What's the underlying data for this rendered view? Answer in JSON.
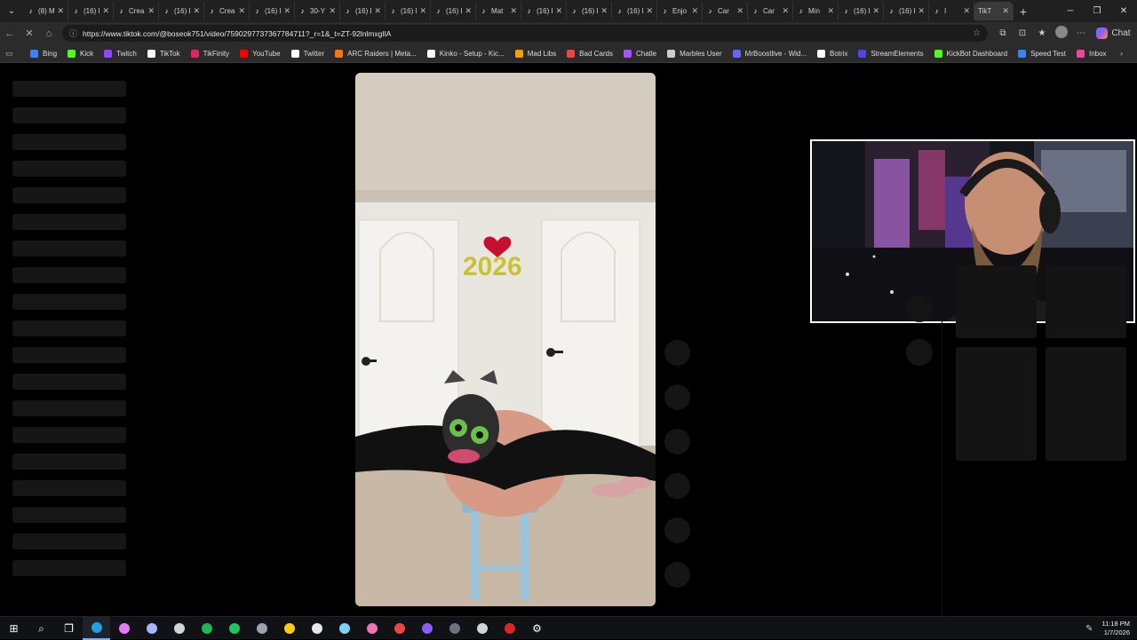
{
  "tabs": [
    {
      "label": "(8) M",
      "icon": "tiktok-icon"
    },
    {
      "label": "(16) I",
      "icon": "tiktok-icon"
    },
    {
      "label": "Crea",
      "icon": "tiktok-icon"
    },
    {
      "label": "(16) I",
      "icon": "tiktok-icon"
    },
    {
      "label": "Crea",
      "icon": "tiktok-icon"
    },
    {
      "label": "(16) I",
      "icon": "tiktok-icon"
    },
    {
      "label": "30-Y",
      "icon": "tiktok-icon"
    },
    {
      "label": "(16) I",
      "icon": "tiktok-icon"
    },
    {
      "label": "(16) I",
      "icon": "tiktok-icon"
    },
    {
      "label": "(16) I",
      "icon": "tiktok-icon"
    },
    {
      "label": "Mat",
      "icon": "tiktok-icon"
    },
    {
      "label": "(16) I",
      "icon": "tiktok-icon"
    },
    {
      "label": "(16) I",
      "icon": "tiktok-icon"
    },
    {
      "label": "(16) I",
      "icon": "tiktok-icon"
    },
    {
      "label": "Enjo",
      "icon": "tiktok-icon"
    },
    {
      "label": "Car",
      "icon": "tiktok-icon"
    },
    {
      "label": "Car",
      "icon": "tiktok-icon"
    },
    {
      "label": "Min",
      "icon": "tiktok-icon"
    },
    {
      "label": "(16) I",
      "icon": "tiktok-icon"
    },
    {
      "label": "(16) I",
      "icon": "tiktok-icon"
    },
    {
      "label": "I",
      "icon": "tiktok-icon"
    }
  ],
  "active_tab": {
    "label": "TikT"
  },
  "address_bar": {
    "url": "https://www.tiktok.com/@boseok751/video/7590297737367784711?_r=1&_t=ZT-92lnlmxgIlA"
  },
  "bookmarks": [
    {
      "label": "Bing",
      "icon": "bing-icon",
      "color": "#3b82f6"
    },
    {
      "label": "Kick",
      "icon": "kick-icon",
      "color": "#53fc18"
    },
    {
      "label": "Twitch",
      "icon": "twitch-icon",
      "color": "#9146ff"
    },
    {
      "label": "TikTok",
      "icon": "tiktok-icon",
      "color": "#ffffff"
    },
    {
      "label": "TikFinity",
      "icon": "tikfinity-icon",
      "color": "#e0245e"
    },
    {
      "label": "YouTube",
      "icon": "youtube-icon",
      "color": "#ff0000"
    },
    {
      "label": "Twitter",
      "icon": "x-icon",
      "color": "#ffffff"
    },
    {
      "label": "ARC Raiders | Meta...",
      "icon": "arc-icon",
      "color": "#f97316"
    },
    {
      "label": "Kinko - Setup - Kic...",
      "icon": "kinko-icon",
      "color": "#ffffff"
    },
    {
      "label": "Mad Libs",
      "icon": "madlibs-icon",
      "color": "#f59e0b"
    },
    {
      "label": "Bad Cards",
      "icon": "badcards-icon",
      "color": "#ef4444"
    },
    {
      "label": "Chatle",
      "icon": "chatle-icon",
      "color": "#a855f7"
    },
    {
      "label": "Marbles User",
      "icon": "globe-icon",
      "color": "#cccccc"
    },
    {
      "label": "MrBoostlive - Wid...",
      "icon": "mrboost-icon",
      "color": "#6366f1"
    },
    {
      "label": "Botrix",
      "icon": "botrix-icon",
      "color": "#ffffff"
    },
    {
      "label": "StreamElements",
      "icon": "streamelements-icon",
      "color": "#4f46e5"
    },
    {
      "label": "KickBot Dashboard",
      "icon": "kickbot-icon",
      "color": "#53fc18"
    },
    {
      "label": "Speed Test",
      "icon": "speedtest-icon",
      "color": "#3b82f6"
    },
    {
      "label": "Inbox",
      "icon": "inbox-icon",
      "color": "#ec4899"
    }
  ],
  "chat_button": {
    "label": "Chat"
  },
  "taskbar": {
    "icons": [
      {
        "name": "windows-start-icon",
        "color": "#ffffff"
      },
      {
        "name": "search-icon",
        "color": "#ffffff"
      },
      {
        "name": "task-view-icon",
        "color": "#ffffff"
      },
      {
        "name": "edge-icon",
        "color": "#1fa0e6"
      },
      {
        "name": "obs-alt-icon",
        "color": "#e879f9"
      },
      {
        "name": "app-icon",
        "color": "#a5b4fc"
      },
      {
        "name": "obs-icon",
        "color": "#d1d5db"
      },
      {
        "name": "spotify-icon",
        "color": "#1db954"
      },
      {
        "name": "app-green-icon",
        "color": "#22c55e"
      },
      {
        "name": "cube-icon",
        "color": "#9ca3af"
      },
      {
        "name": "file-explorer-icon",
        "color": "#facc15"
      },
      {
        "name": "app-cloud-icon",
        "color": "#e5e7eb"
      },
      {
        "name": "notepad-icon",
        "color": "#7dd3fc"
      },
      {
        "name": "app-colorful-icon",
        "color": "#f472b6"
      },
      {
        "name": "app-red-icon",
        "color": "#ef4444"
      },
      {
        "name": "app-purple-icon",
        "color": "#8b5cf6"
      },
      {
        "name": "terminal-icon",
        "color": "#6b7280"
      },
      {
        "name": "app-gray-icon",
        "color": "#d1d5db"
      },
      {
        "name": "app-red2-icon",
        "color": "#dc2626"
      },
      {
        "name": "settings-icon",
        "color": "#ffffff"
      }
    ],
    "time": "11:18 PM",
    "date": "1/7/2026"
  },
  "video": {
    "overlay_text": "2026"
  }
}
